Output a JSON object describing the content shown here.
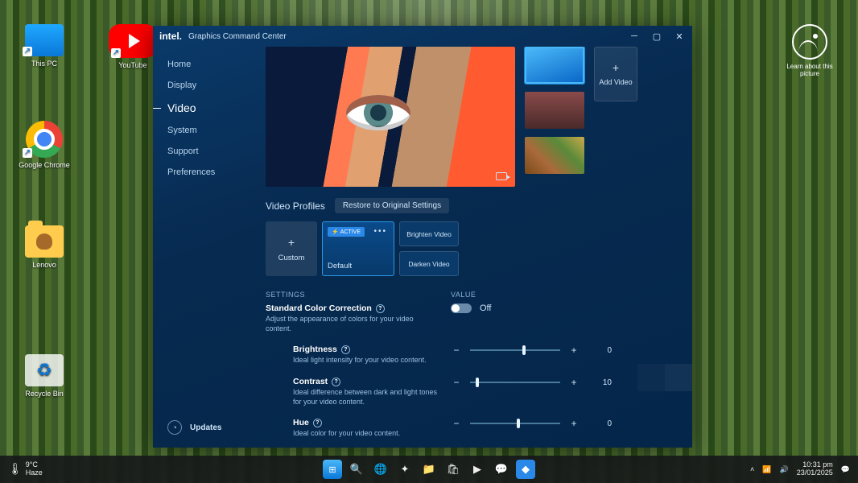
{
  "desktop": {
    "icons": {
      "this_pc": "This PC",
      "youtube": "YouTube",
      "chrome": "Google Chrome",
      "lenovo": "Lenovo",
      "recycle": "Recycle Bin",
      "learn": "Learn about this picture"
    }
  },
  "app": {
    "brand": "intel.",
    "title": "Graphics Command Center",
    "sidebar": {
      "items": [
        "Home",
        "Display",
        "Video",
        "System",
        "Support",
        "Preferences"
      ],
      "active": "Video",
      "updates": "Updates"
    },
    "profiles": {
      "section": "Video Profiles",
      "restore": "Restore to Original Settings",
      "custom": "Custom",
      "default": "Default",
      "active_badge": "ACTIVE",
      "brighten": "Brighten Video",
      "darken": "Darken Video",
      "add_video": "Add Video"
    },
    "settings": {
      "head_settings": "SETTINGS",
      "head_value": "VALUE",
      "scc": {
        "label": "Standard Color Correction",
        "desc": "Adjust the appearance of colors for your video content.",
        "state": "Off"
      },
      "brightness": {
        "label": "Brightness",
        "desc": "Ideal light intensity for your video content.",
        "value": "0",
        "knob_pct": 58
      },
      "contrast": {
        "label": "Contrast",
        "desc": "Ideal difference between dark and light tones for your video content.",
        "value": "10",
        "knob_pct": 6
      },
      "hue": {
        "label": "Hue",
        "desc": "Ideal color for your video content.",
        "value": "0",
        "knob_pct": 52
      }
    }
  },
  "taskbar": {
    "weather": {
      "temp": "9°C",
      "cond": "Haze"
    },
    "time": "10:31 pm",
    "date": "23/01/2025"
  }
}
